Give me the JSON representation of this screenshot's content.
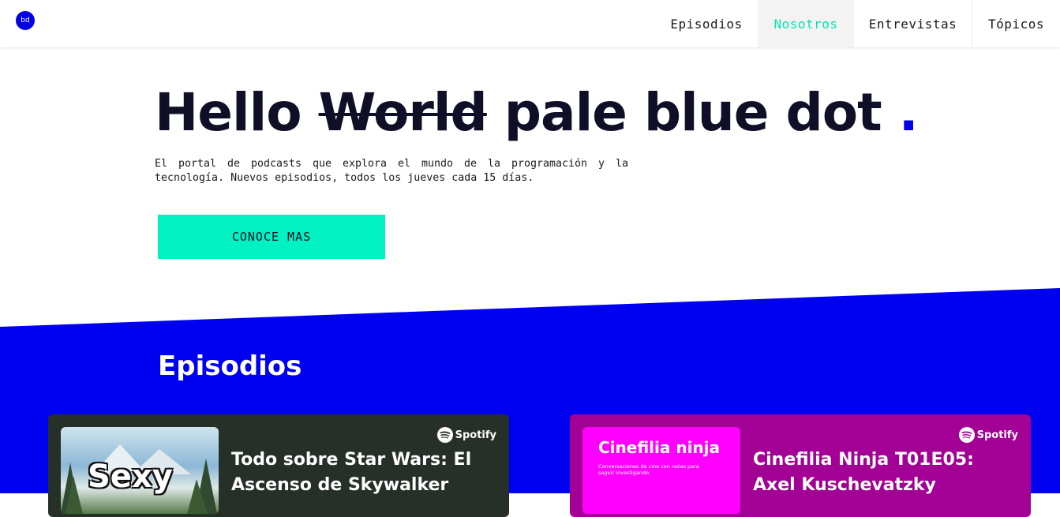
{
  "header": {
    "logo_text": "bd",
    "nav": [
      {
        "label": "Episodios"
      },
      {
        "label": "Nosotros",
        "active": true
      },
      {
        "label": "Entrevistas"
      },
      {
        "label": "Tópicos"
      }
    ]
  },
  "hero": {
    "title_word1": "Hello",
    "title_struck": "World",
    "title_rest": "pale blue dot",
    "title_dot": ".",
    "description": "El portal de podcasts que explora el mundo de la programación y la tecnología. Nuevos episodios, todos los jueves cada 15 días.",
    "cta_label": "CONOCE MAS"
  },
  "episodes": {
    "section_title": "Episodios",
    "cards": [
      {
        "title": "Todo sobre Star Wars: El Ascenso de Skywalker",
        "badge": "Spotify",
        "thumb_text": "Sexy",
        "bg_color": "#262f28"
      },
      {
        "title": "Cinefilia Ninja T01E05: Axel Kuschevatzky",
        "badge": "Spotify",
        "thumb_title": "Cinefilia ninja",
        "thumb_subtitle": "Conversaciones de cine con notas para seguir investigando.",
        "bg_color": "#a30096"
      }
    ]
  },
  "colors": {
    "brand_blue": "#0000e6",
    "accent_teal": "#00f2c3",
    "text_dark": "#0f1027"
  }
}
